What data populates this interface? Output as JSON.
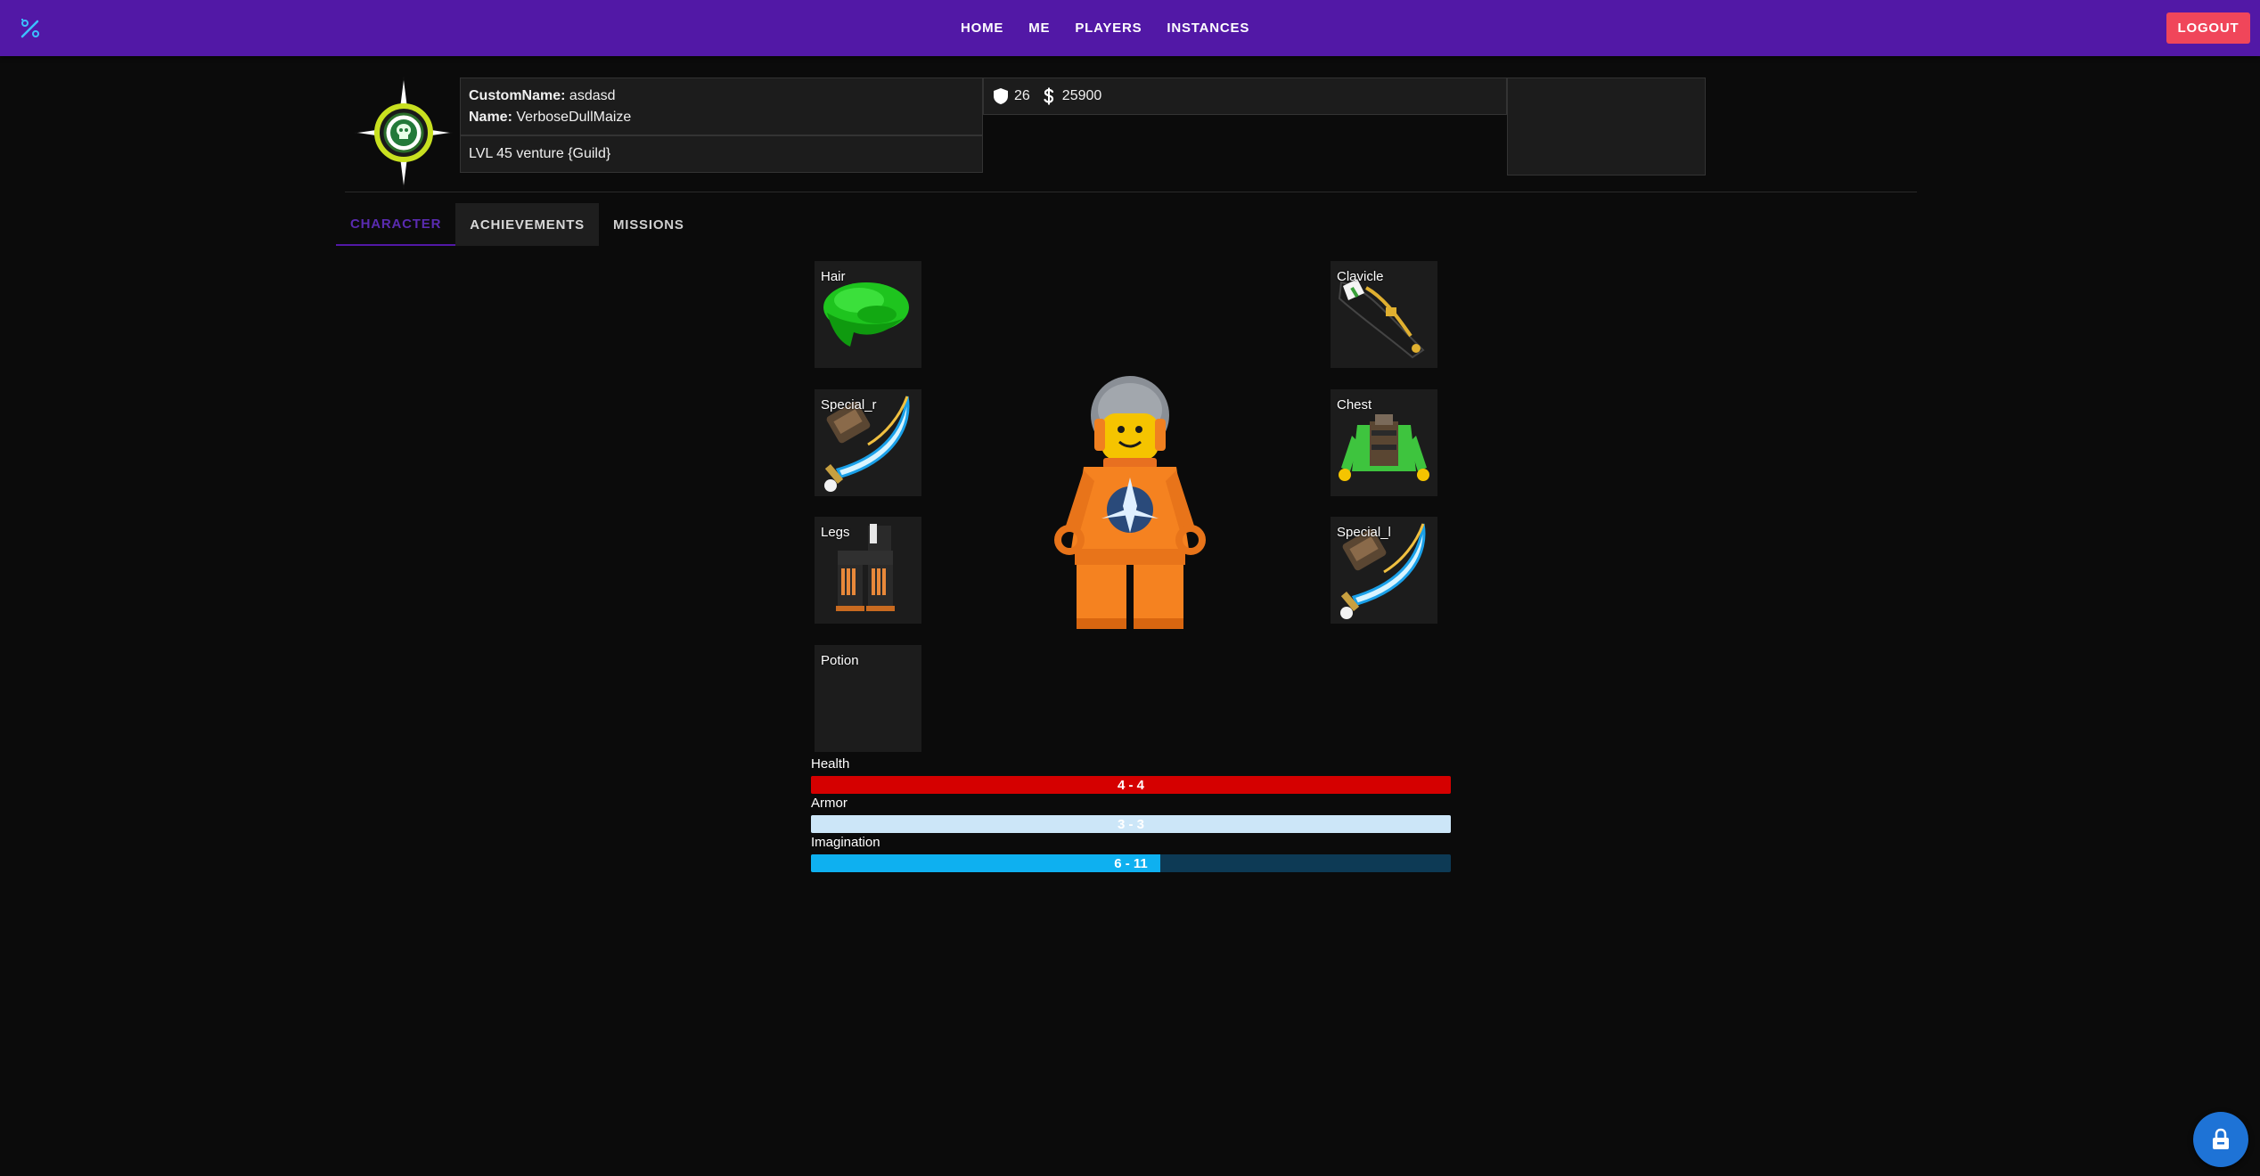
{
  "nav": {
    "logo_icon": "wand-sparkle-icon",
    "links": [
      "HOME",
      "ME",
      "PLAYERS",
      "INSTANCES"
    ],
    "logout_label": "LOGOUT",
    "accent": "#5218a6",
    "logout_color": "#f0465a"
  },
  "profile": {
    "emblem_icon": "compass-skull-emblem-icon",
    "custom_name_key": "CustomName:",
    "custom_name": "asdasd",
    "name_key": "Name:",
    "name": "VerboseDullMaize",
    "level_line": "LVL 45 venture {Guild}",
    "shield_icon": "shield-icon",
    "armor_stat": "26",
    "coin_icon": "dollar-icon",
    "currency": "25900"
  },
  "tabs": [
    {
      "label": "CHARACTER",
      "active": true
    },
    {
      "label": "ACHIEVEMENTS",
      "active": false
    },
    {
      "label": "MISSIONS",
      "active": false
    }
  ],
  "slots": {
    "hair": {
      "label": "Hair",
      "icon": "green-hair-icon"
    },
    "special_r": {
      "label": "Special_r",
      "icon": "curved-sword-icon"
    },
    "legs": {
      "label": "Legs",
      "icon": "orange-legs-icon"
    },
    "potion": {
      "label": "Potion",
      "icon": ""
    },
    "clavicle": {
      "label": "Clavicle",
      "icon": "shoulder-pad-icon"
    },
    "chest": {
      "label": "Chest",
      "icon": "chest-torso-icon"
    },
    "special_l": {
      "label": "Special_l",
      "icon": "curved-sword-icon"
    }
  },
  "character_icon": "orange-space-minifig",
  "stats": {
    "health": {
      "label": "Health",
      "text": "4 - 4",
      "current": 4,
      "max": 4,
      "color": "#d50000"
    },
    "armor": {
      "label": "Armor",
      "text": "3 - 3",
      "current": 3,
      "max": 3,
      "color": "#cce6f8"
    },
    "imagination": {
      "label": "Imagination",
      "text": "6 - 11",
      "current": 6,
      "max": 11,
      "color": "#0eb0f0",
      "track_color": "#0d3a55"
    }
  },
  "fab_icon": "lock-icon"
}
